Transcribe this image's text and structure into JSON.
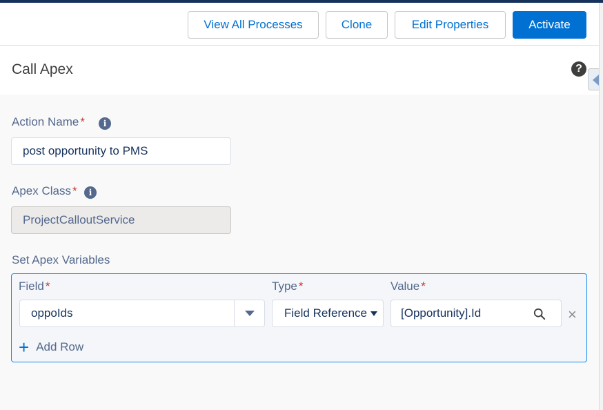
{
  "toolbar": {
    "view_all_label": "View All Processes",
    "clone_label": "Clone",
    "edit_properties_label": "Edit Properties",
    "activate_label": "Activate"
  },
  "panel": {
    "title": "Call Apex",
    "help_icon": "?"
  },
  "form": {
    "action_name": {
      "label": "Action Name",
      "required": "*",
      "value": "post opportunity to PMS"
    },
    "apex_class": {
      "label": "Apex Class",
      "required": "*",
      "value": "ProjectCalloutService"
    },
    "set_vars_label": "Set Apex Variables"
  },
  "variables": {
    "columns": {
      "field": "Field",
      "type": "Type",
      "value": "Value",
      "required": "*"
    },
    "rows": [
      {
        "field": "oppoIds",
        "type": "Field Reference",
        "value": "[Opportunity].Id"
      }
    ],
    "add_row_label": "Add Row",
    "add_icon": "+",
    "remove_icon": "×"
  },
  "colors": {
    "brand": "#0070d2",
    "required": "#c23934",
    "label": "#54698d"
  }
}
